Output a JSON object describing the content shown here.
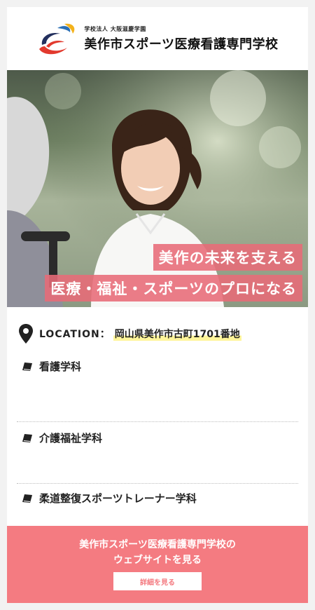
{
  "header": {
    "corporation": "学校法人 大阪滋慶学園",
    "school_name": "美作市スポーツ医療看護専門学校"
  },
  "hero": {
    "banner_line1": "美作の未来を支える",
    "banner_line2": "医療・福祉・スポーツのプロになる"
  },
  "location": {
    "label": "LOCATION：",
    "value": "岡山県美作市古町1701番地",
    "icon": "map-pin-icon"
  },
  "departments": [
    {
      "label": "看護学科",
      "icon": "book-icon"
    },
    {
      "label": "介護福祉学科",
      "icon": "book-icon"
    },
    {
      "label": "柔道整復スポーツトレーナー学科",
      "icon": "book-icon"
    }
  ],
  "cta": {
    "line1": "美作市スポーツ医療看護専門学校の",
    "line2": "ウェブサイトを見る",
    "button_label": "詳細を見る"
  },
  "colors": {
    "accent": "#f47b81",
    "banner": "#e86b78",
    "highlight": "#fff59a",
    "background": "#f2f2f2"
  }
}
